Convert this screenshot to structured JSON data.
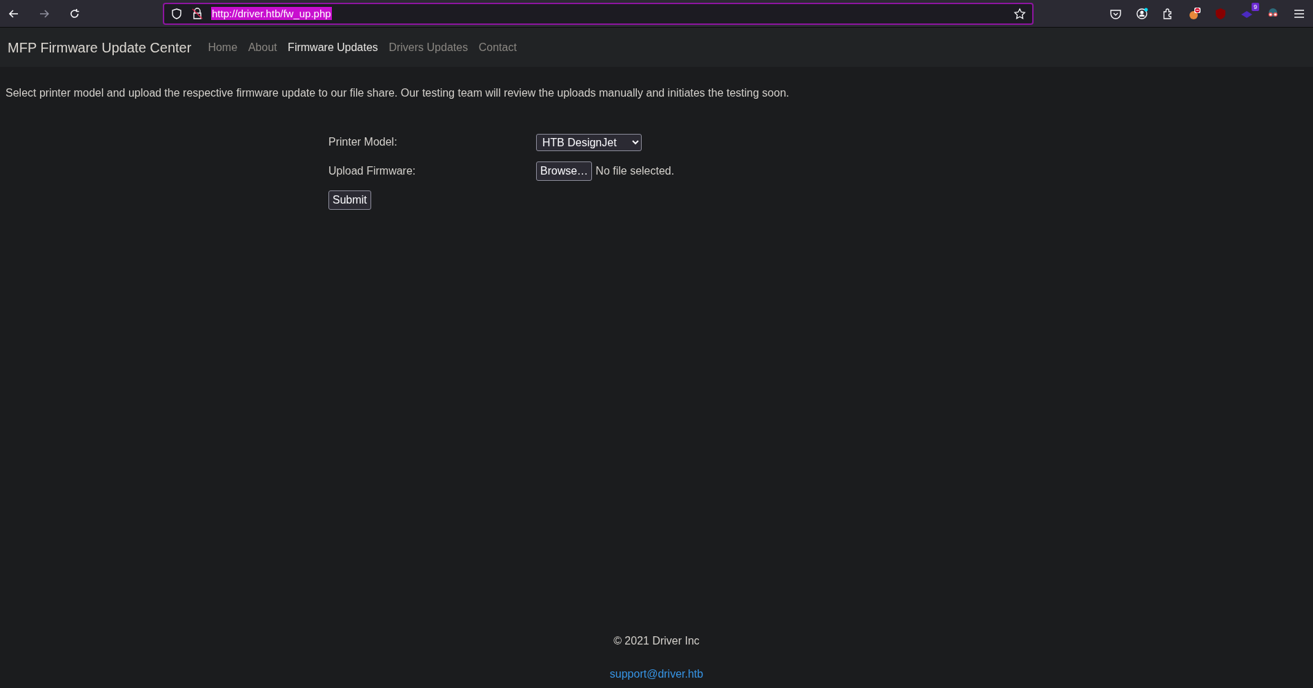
{
  "browser": {
    "url": "http://driver.htb/fw_up.php",
    "forward_disabled": true,
    "extension_badge": "9"
  },
  "navbar": {
    "brand": "MFP Firmware Update Center",
    "items": [
      {
        "label": "Home",
        "selected": false
      },
      {
        "label": "About",
        "selected": false
      },
      {
        "label": "Firmware Updates",
        "selected": true
      },
      {
        "label": "Drivers Updates",
        "selected": false
      },
      {
        "label": "Contact",
        "selected": false
      }
    ]
  },
  "intro": "Select printer model and upload the respective firmware update to our file share. Our testing team will review the uploads manually and initiates the testing soon.",
  "form": {
    "printer_model_label": "Printer Model:",
    "printer_model_value": "HTB DesignJet",
    "upload_label": "Upload Firmware:",
    "browse_button": "Browse…",
    "file_status": "No file selected.",
    "submit": "Submit"
  },
  "footer": {
    "copyright": "© 2021 Driver Inc",
    "email": "support@driver.htb"
  }
}
